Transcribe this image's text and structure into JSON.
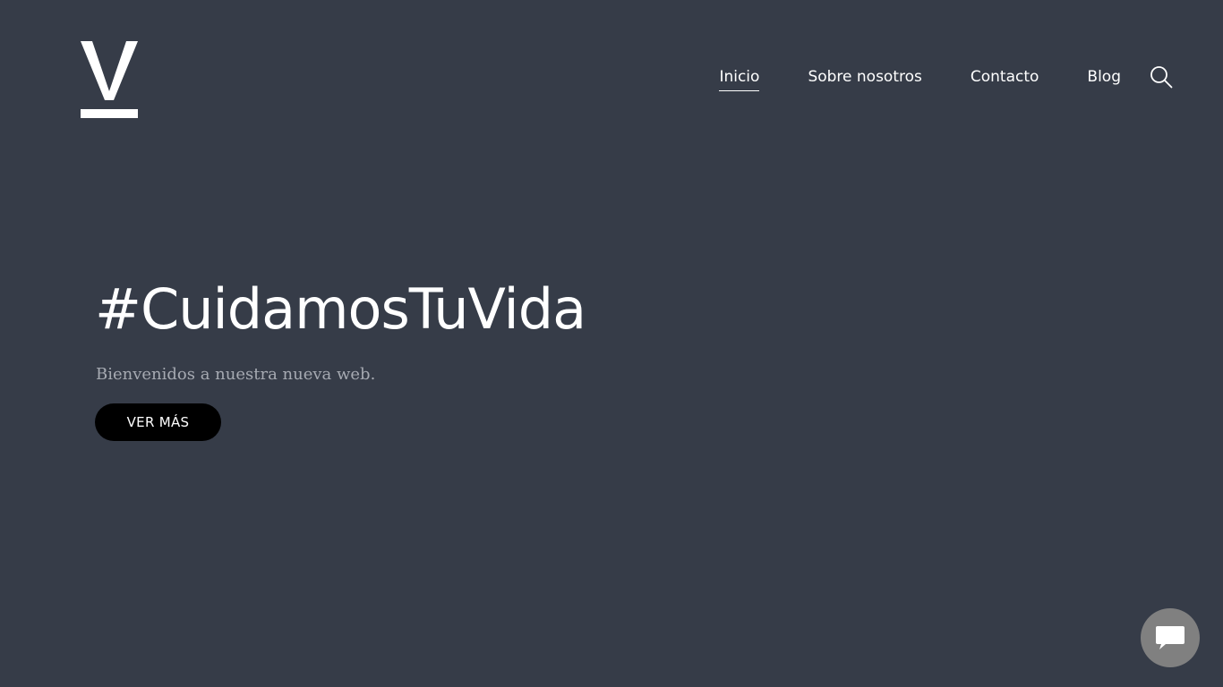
{
  "header": {
    "logo_icon": "v-logo-icon",
    "nav": [
      {
        "label": "Inicio",
        "active": true
      },
      {
        "label": "Sobre nosotros",
        "active": false
      },
      {
        "label": "Contacto",
        "active": false
      },
      {
        "label": "Blog",
        "active": false
      }
    ],
    "search_icon": "search-icon"
  },
  "hero": {
    "title": "#CuidamosTuVida",
    "subtitle": "Bienvenidos a nuestra nueva web.",
    "cta_label": "VER MÁS"
  },
  "chat": {
    "icon": "chat-icon"
  },
  "colors": {
    "background": "#363c48",
    "text": "#ffffff",
    "subtitle": "#a6aab2",
    "button": "#000000",
    "chat_bubble": "#808080"
  }
}
